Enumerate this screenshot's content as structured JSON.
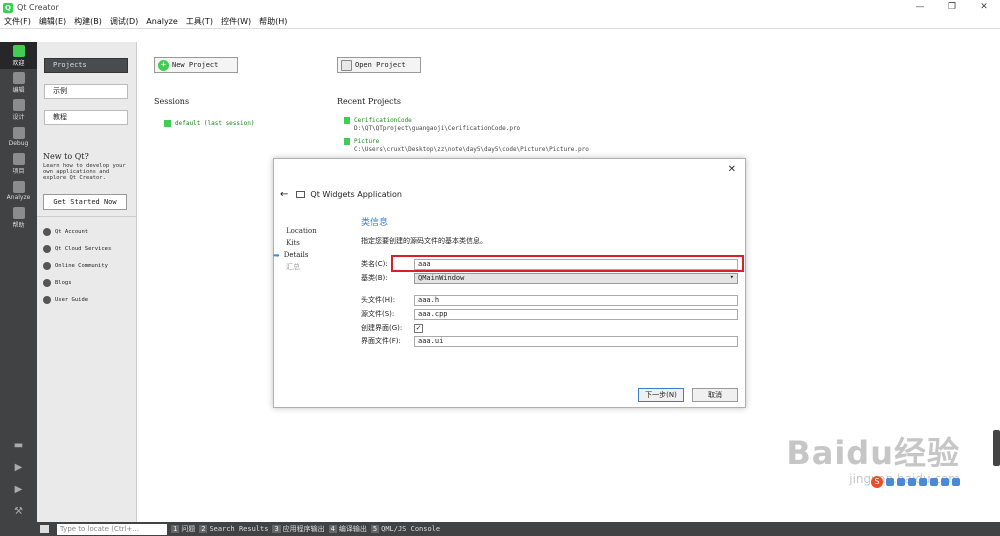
{
  "window": {
    "title": "Qt Creator",
    "controls": [
      "—",
      "❐",
      "✕"
    ]
  },
  "menu": [
    "文件(F)",
    "编辑(E)",
    "构建(B)",
    "调试(D)",
    "Analyze",
    "工具(T)",
    "控件(W)",
    "帮助(H)"
  ],
  "modes": [
    {
      "label": "欢迎",
      "active": true
    },
    {
      "label": "编辑",
      "active": false
    },
    {
      "label": "设计",
      "active": false
    },
    {
      "label": "Debug",
      "active": false
    },
    {
      "label": "项目",
      "active": false
    },
    {
      "label": "Analyze",
      "active": false
    },
    {
      "label": "帮助",
      "active": false
    }
  ],
  "welcome_side": {
    "projects": "Projects",
    "examples": "示例",
    "tutorials": "教程",
    "new_to_qt_title": "New to Qt?",
    "new_to_qt_text": "Learn how to develop your own applications and explore Qt Creator.",
    "get_started": "Get Started Now",
    "links": [
      "Qt Account",
      "Qt Cloud Services",
      "Online Community",
      "Blogs",
      "User Guide"
    ]
  },
  "main": {
    "new_project": "New Project",
    "open_project": "Open Project",
    "sessions_title": "Sessions",
    "session_item": "default (last session)",
    "recent_title": "Recent Projects",
    "recent": [
      {
        "name": "CerificationCode",
        "path": "D:\\QT\\QTproject\\guangaoji\\CerificationCode.pro"
      },
      {
        "name": "Picture",
        "path": "C:\\Users\\cruxt\\Desktop\\zz\\note\\day5\\day5\\code\\Picture\\Picture.pro"
      }
    ]
  },
  "dialog": {
    "close": "✕",
    "back": "←",
    "title": "Qt Widgets Application",
    "steps": [
      "Location",
      "Kits",
      "Details",
      "汇总"
    ],
    "current_step_arrow": "➡",
    "section_title": "类信息",
    "description": "指定您要创建的源码文件的基本类信息。",
    "fields": {
      "class_name_label": "类名(C):",
      "class_name_value": "aaa",
      "base_class_label": "基类(B):",
      "base_class_value": "QMainWindow",
      "header_label": "头文件(H):",
      "header_value": "aaa.h",
      "source_label": "源文件(S):",
      "source_value": "aaa.cpp",
      "create_form_label": "创建界面(G):",
      "create_form_check": "✓",
      "form_label": "界面文件(F):",
      "form_value": "aaa.ui"
    },
    "next": "下一步(N)",
    "cancel": "取消"
  },
  "statusbar": {
    "locator_placeholder": "Type to locate (Ctrl+...",
    "panes": [
      {
        "n": "1",
        "t": "问题"
      },
      {
        "n": "2",
        "t": "Search Results"
      },
      {
        "n": "3",
        "t": "应用程序输出"
      },
      {
        "n": "4",
        "t": "编译输出"
      },
      {
        "n": "5",
        "t": "QML/JS Console"
      }
    ]
  },
  "watermark": {
    "big": "Baidu经验",
    "small": "jingyan.baidu.com"
  },
  "colors": {
    "accent_green": "#41cd52",
    "highlight_red": "#d8202a",
    "link_blue": "#3a7fc9"
  }
}
